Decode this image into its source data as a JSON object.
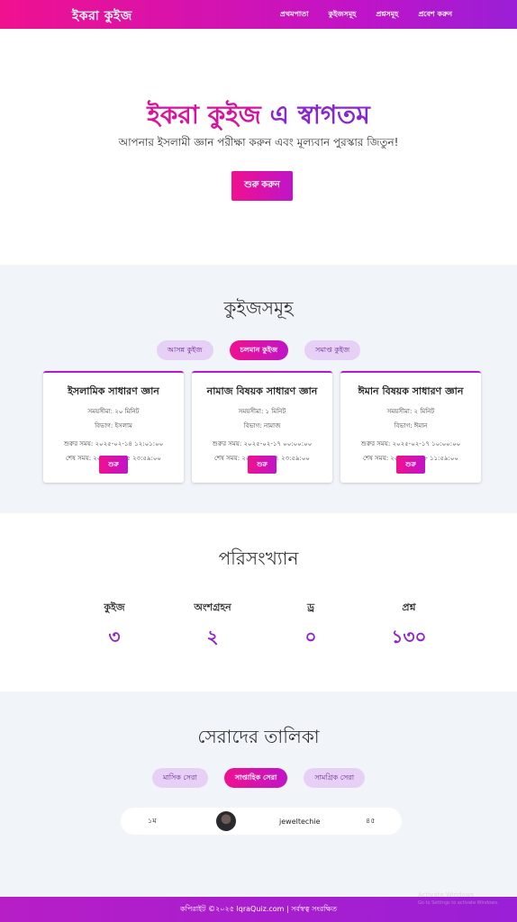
{
  "nav": {
    "logo": "ইকরা কুইজ",
    "links": [
      "প্রথমপাতা",
      "কুইজসমূহ",
      "প্রশ্নসমূহ",
      "প্রবেশ করুন"
    ]
  },
  "hero": {
    "title_brand": "ইকরা কুইজ",
    "title_rest": " এ স্বাগতম",
    "subtitle": "আপনার ইসলামী জ্ঞান পরীক্ষা করুন এবং মূল্যবান পুরস্কার জিতুন!",
    "button": "শুরু করুন"
  },
  "quizzes": {
    "title": "কুইজসমূহ",
    "tabs": [
      "আসন্ন কুইজ",
      "চলমান কুইজ",
      "সমাপ্ত কুইজ"
    ],
    "active_tab": 1,
    "cards": [
      {
        "title": "ইসলামিক সাধারণ জ্ঞান",
        "time_limit": "সময়সীমা: ২০ মিনিট",
        "category": "বিভাগ: ইসলাম",
        "start": "শুরুর সময়: ২০২৫-০২-১৪ ১২:০১:০০",
        "end": "শেষ সময়: ২০২৫-০২-২৫ ২৩:৫৯:০০",
        "button": "শুরু"
      },
      {
        "title": "নামাজ বিষয়ক সাধারণ জ্ঞান",
        "time_limit": "সময়সীমা: ১ মিনিট",
        "category": "বিভাগ: নামাজ",
        "start": "শুরুর সময়: ২০২৫-০২-১৭ ০০:০০:০০",
        "end": "শেষ সময়: ২০২৫-০২-২৭ ২৩:৫৯:০০",
        "button": "শুরু"
      },
      {
        "title": "ঈমান বিষয়ক সাধারণ জ্ঞান",
        "time_limit": "সময়সীমা: ২ মিনিট",
        "category": "বিভাগ: ঈমান",
        "start": "শুরুর সময়: ২০২৫-০২-১৭ ১০:০০:০০",
        "end": "শেষ সময়: ২০২৫-০২-২৮ ১১:৫৯:০০",
        "button": "শুরু"
      }
    ]
  },
  "stats": {
    "title": "পরিসংখ্যান",
    "items": [
      {
        "label": "কুইজ",
        "value": "৩"
      },
      {
        "label": "অংশগ্রহন",
        "value": "২"
      },
      {
        "label": "ড্র",
        "value": "০"
      },
      {
        "label": "প্রশ্ন",
        "value": "১৩০"
      }
    ]
  },
  "leaderboard": {
    "title": "সেরাদের তালিকা",
    "tabs": [
      "মাসিক সেরা",
      "সাপ্তাহিক সেরা",
      "সামগ্রিক সেরা"
    ],
    "active_tab": 1,
    "rows": [
      {
        "rank": "১ম",
        "name": "jeweltechie",
        "score": "৪৫"
      }
    ]
  },
  "footer": {
    "text": "কপিরাইট ©২০২৫ IqraQuiz.com | সর্বস্বত্ব সংরক্ষিত"
  },
  "watermark": {
    "line1": "Activate Windows",
    "line2": "Go to Settings to activate Windows."
  },
  "colors": {
    "brand_pink": "#f0118f",
    "brand_purple": "#9a1fd6",
    "stat_value": "#9224c9",
    "section_bg": "#f1f5f9"
  }
}
